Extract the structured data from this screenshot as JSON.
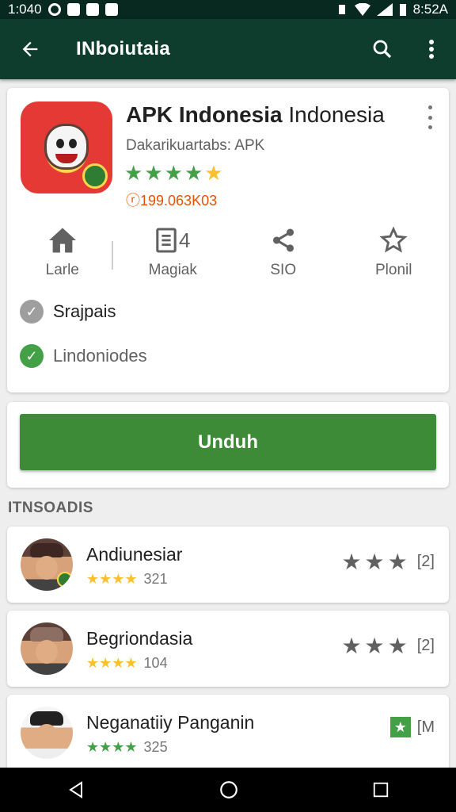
{
  "status_bar": {
    "time": "1:040",
    "right_time": "8:52A"
  },
  "app_bar": {
    "title": "INboiutaia"
  },
  "app": {
    "name_bold": "APK Indonesia",
    "name_regular": "Indonesia",
    "developer": "Dakarikuartabs: APK",
    "rating": 4.5,
    "downloads": "ⓡ199.063K03",
    "actions": [
      {
        "label": "Larle",
        "icon": "home-icon"
      },
      {
        "label": "Magiak",
        "icon": "document-icon",
        "badge": "4"
      },
      {
        "label": "SIO",
        "icon": "share-icon"
      },
      {
        "label": "Plonil",
        "icon": "star-outline-icon"
      }
    ],
    "checks": [
      {
        "label": "Srajpais",
        "color": "#9e9e9e"
      },
      {
        "label": "Lindoniodes",
        "color": "#43a047"
      }
    ]
  },
  "install_button": "Unduh",
  "section_header": "ITNSOADIS",
  "list": [
    {
      "name": "Andiunesiar",
      "count": "321",
      "stars_color": "yellow",
      "right_text": "[2]",
      "right_type": "grey-stars"
    },
    {
      "name": "Begriondasia",
      "count": "104",
      "stars_color": "yellow",
      "right_text": "[2]",
      "right_type": "grey-stars"
    },
    {
      "name": "Neganatiiy Panganin",
      "count": "325",
      "stars_color": "green",
      "right_text": "[M",
      "right_type": "green-box"
    }
  ],
  "colors": {
    "app_bar": "#0e3d2e",
    "accent_green": "#3d8b37",
    "star_yellow": "#fbc02d"
  }
}
